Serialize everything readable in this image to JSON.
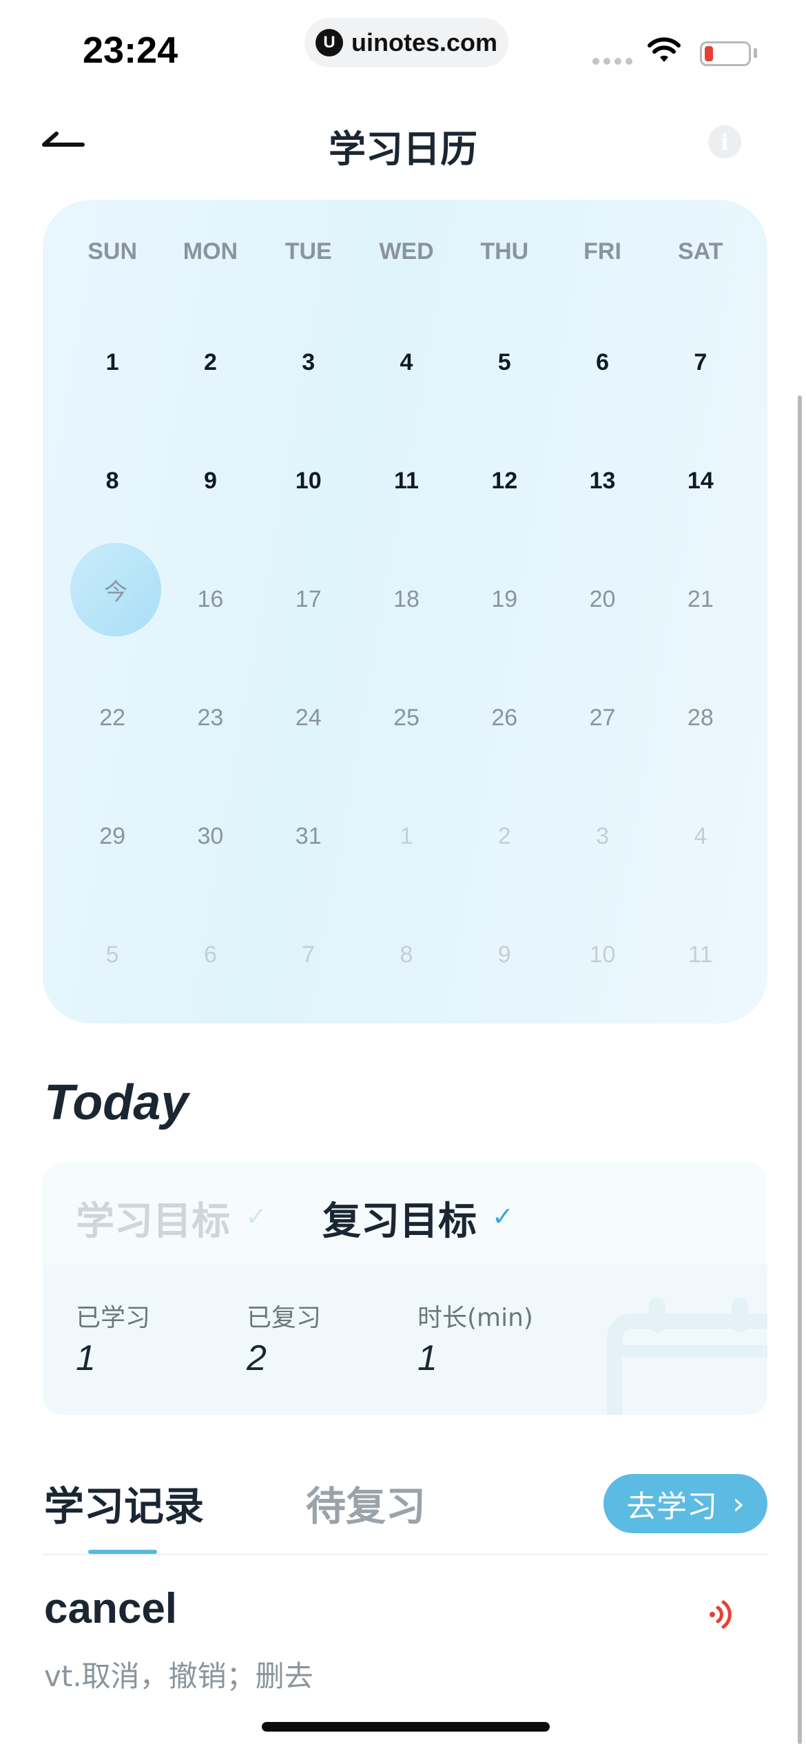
{
  "status_bar": {
    "time": "23:24",
    "url": "uinotes.com",
    "url_logo": "U"
  },
  "nav": {
    "title": "学习日历",
    "info": "i"
  },
  "calendar": {
    "weekdays": [
      "SUN",
      "MON",
      "TUE",
      "WED",
      "THU",
      "FRI",
      "SAT"
    ],
    "weeks": [
      [
        "1",
        "2",
        "3",
        "4",
        "5",
        "6",
        "7"
      ],
      [
        "8",
        "9",
        "10",
        "11",
        "12",
        "13",
        "14"
      ],
      [
        "今",
        "16",
        "17",
        "18",
        "19",
        "20",
        "21"
      ],
      [
        "22",
        "23",
        "24",
        "25",
        "26",
        "27",
        "28"
      ],
      [
        "29",
        "30",
        "31",
        "1",
        "2",
        "3",
        "4"
      ],
      [
        "5",
        "6",
        "7",
        "8",
        "9",
        "10",
        "11"
      ]
    ]
  },
  "today": {
    "heading": "Today",
    "goal_tabs": [
      "学习目标",
      "复习目标"
    ],
    "check_mark": "✓",
    "stats": [
      {
        "label": "已学习",
        "value": "1"
      },
      {
        "label": "已复习",
        "value": "2"
      },
      {
        "label": "时长(min)",
        "value": "1"
      }
    ]
  },
  "records": {
    "tab_record": "学习记录",
    "tab_review": "待复习",
    "go_button": "去学习",
    "go_chevron": "›",
    "word": "cancel",
    "meaning": "vt.取消，撤销；删去"
  },
  "colors": {
    "accent": "#5bbbe3",
    "speaker": "#e74034",
    "text": "#1b2633"
  }
}
